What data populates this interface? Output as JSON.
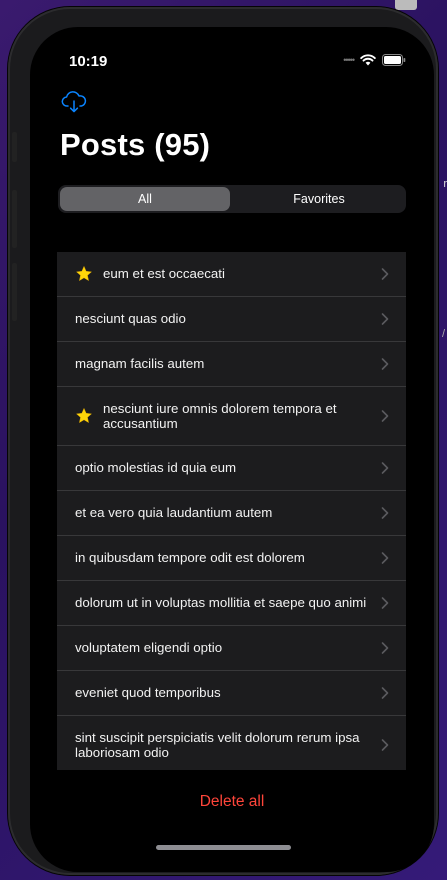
{
  "status_bar": {
    "time": "10:19"
  },
  "header": {
    "title": "Posts (95)"
  },
  "segmented": {
    "options": [
      "All",
      "Favorites"
    ],
    "selected": "All"
  },
  "posts": [
    {
      "title": "eum et est occaecati",
      "favorite": true
    },
    {
      "title": "nesciunt quas odio",
      "favorite": false
    },
    {
      "title": "magnam facilis autem",
      "favorite": false
    },
    {
      "title": "nesciunt iure omnis dolorem tempora et accusantium",
      "favorite": true
    },
    {
      "title": "optio molestias id quia eum",
      "favorite": false
    },
    {
      "title": "et ea vero quia laudantium autem",
      "favorite": false
    },
    {
      "title": "in quibusdam tempore odit est dolorem",
      "favorite": false
    },
    {
      "title": "dolorum ut in voluptas mollitia et saepe quo animi",
      "favorite": false
    },
    {
      "title": "voluptatem eligendi optio",
      "favorite": false
    },
    {
      "title": "eveniet quod temporibus",
      "favorite": false
    },
    {
      "title": "sint suscipit perspiciatis velit dolorum rerum ipsa laboriosam odio",
      "favorite": false
    }
  ],
  "footer": {
    "delete_label": "Delete all"
  },
  "background": {
    "fragment_1": "r",
    "fragment_2": "/"
  },
  "colors": {
    "accent": "#0a84ff",
    "destructive": "#ff453a",
    "star": "#ffd60a"
  },
  "icons": {
    "cloud": "cloud-download-icon",
    "star": "star-icon",
    "chevron": "chevron-right-icon"
  }
}
